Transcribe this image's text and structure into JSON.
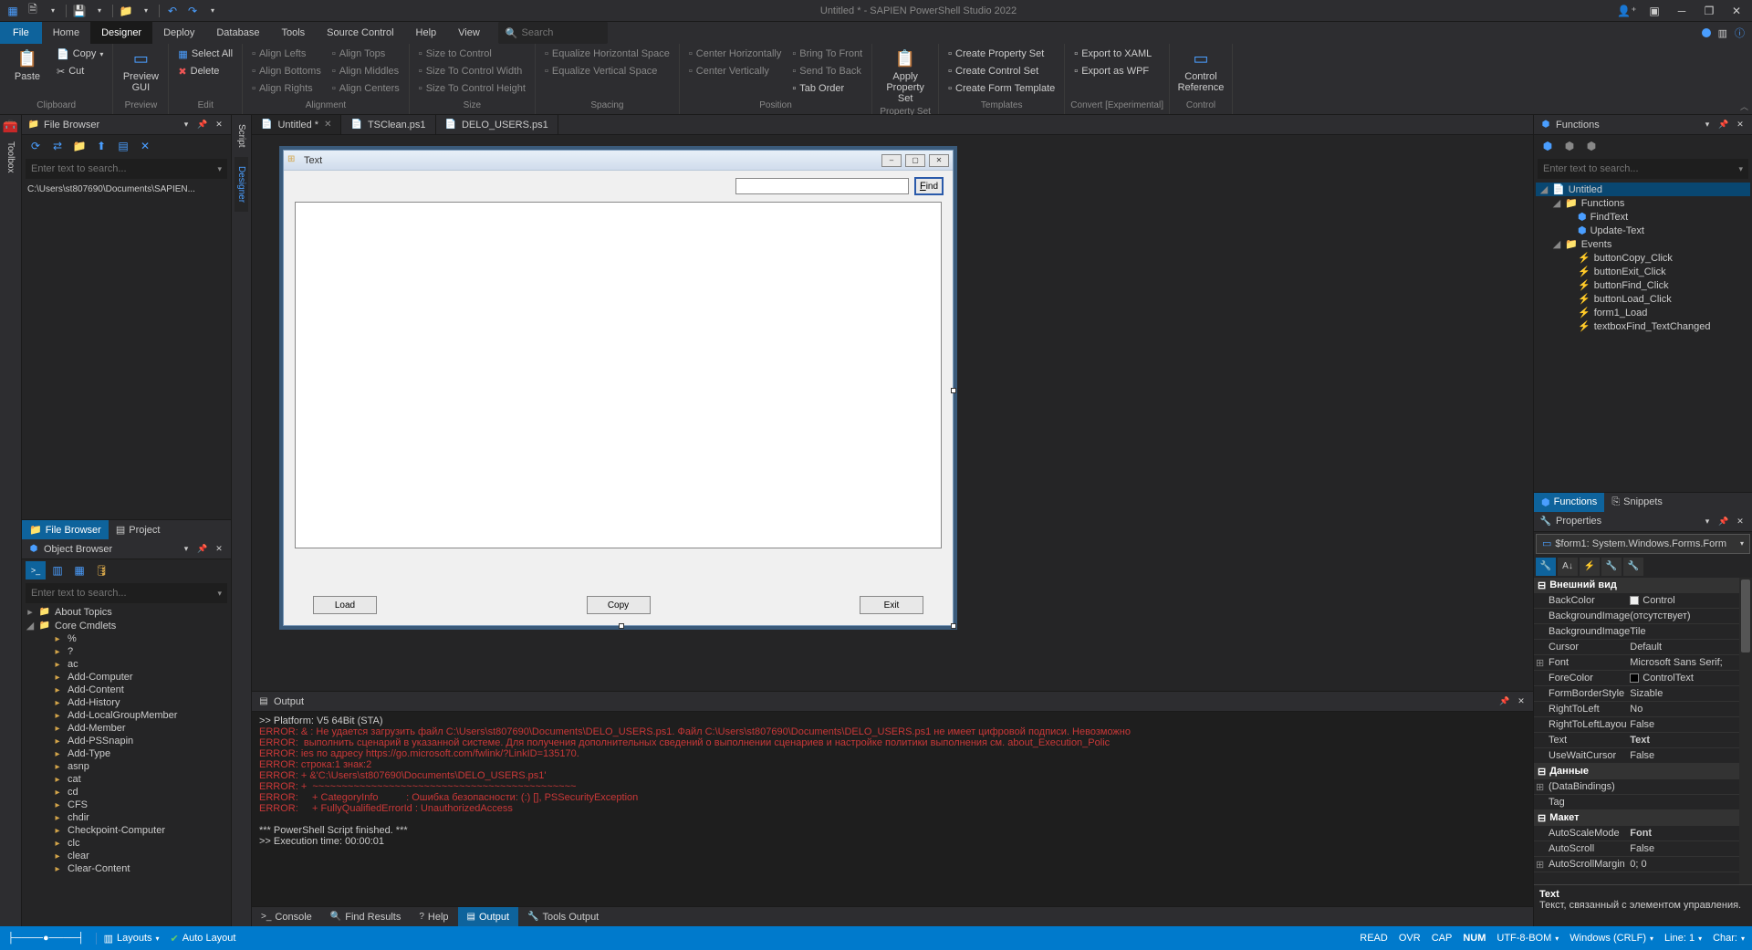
{
  "titlebar": {
    "title": "Untitled * - SAPIEN PowerShell Studio 2022"
  },
  "menu": {
    "file": "File",
    "items": [
      "Home",
      "Designer",
      "Deploy",
      "Database",
      "Tools",
      "Source Control",
      "Help",
      "View"
    ],
    "active": "Designer",
    "search_placeholder": "Search"
  },
  "ribbon": {
    "clipboard": {
      "label": "Clipboard",
      "paste": "Paste",
      "copy": "Copy",
      "cut": "Cut"
    },
    "preview": {
      "label": "Preview",
      "gui": "Preview\nGUI"
    },
    "edit": {
      "label": "Edit",
      "selectall": "Select All",
      "delete": "Delete"
    },
    "alignment": {
      "label": "Alignment",
      "items": [
        "Align Lefts",
        "Align Bottoms",
        "Align Rights",
        "Align Tops",
        "Align Middles",
        "Align Centers"
      ]
    },
    "size": {
      "label": "Size",
      "items": [
        "Size to Control",
        "Size To Control Width",
        "Size To Control Height"
      ]
    },
    "spacing": {
      "label": "Spacing",
      "items": [
        "Equalize Horizontal Space",
        "Equalize Vertical Space"
      ]
    },
    "position": {
      "label": "Position",
      "items": [
        "Center Horizontally",
        "Center Vertically",
        "Bring To Front",
        "Send To Back",
        "Tab Order"
      ]
    },
    "propertyset": {
      "label": "Property Set",
      "apply": "Apply\nProperty Set"
    },
    "templates": {
      "label": "Templates",
      "items": [
        "Create Property Set",
        "Create Control Set",
        "Create Form Template"
      ]
    },
    "convert": {
      "label": "Convert [Experimental]",
      "items": [
        "Export to XAML",
        "Export as WPF"
      ]
    },
    "control": {
      "label": "Control",
      "ref": "Control\nReference"
    }
  },
  "file_browser": {
    "title": "File Browser",
    "search_placeholder": "Enter text to search...",
    "path": "C:\\Users\\st807690\\Documents\\SAPIEN...",
    "tabs": [
      "File Browser",
      "Project"
    ],
    "active": "File Browser"
  },
  "object_browser": {
    "title": "Object Browser",
    "search_placeholder": "Enter text to search...",
    "roots": [
      {
        "exp": "▸",
        "label": "About Topics"
      },
      {
        "exp": "◢",
        "label": "Core Cmdlets"
      }
    ],
    "items": [
      "%",
      "?",
      "ac",
      "Add-Computer",
      "Add-Content",
      "Add-History",
      "Add-LocalGroupMember",
      "Add-Member",
      "Add-PSSnapin",
      "Add-Type",
      "asnp",
      "cat",
      "cd",
      "CFS",
      "chdir",
      "Checkpoint-Computer",
      "clc",
      "clear",
      "Clear-Content"
    ]
  },
  "doc_tabs": [
    {
      "label": "Untitled *",
      "active": true,
      "closable": true
    },
    {
      "label": "TSClean.ps1",
      "active": false
    },
    {
      "label": "DELO_USERS.ps1",
      "active": false
    }
  ],
  "side_tabs": {
    "script": "Script",
    "designer": "Designer"
  },
  "form": {
    "title": "Text",
    "find": "Find",
    "load": "Load",
    "copy": "Copy",
    "exit": "Exit"
  },
  "output": {
    "title": "Output",
    "lines": [
      {
        "t": ">> Platform: V5 64Bit (STA)",
        "err": false
      },
      {
        "t": "ERROR: & : Не удается загрузить файл C:\\Users\\st807690\\Documents\\DELO_USERS.ps1. Файл C:\\Users\\st807690\\Documents\\DELO_USERS.ps1 не имеет цифровой подписи. Невозможно",
        "err": true
      },
      {
        "t": "ERROR:  выполнить сценарий в указанной системе. Для получения дополнительных сведений о выполнении сценариев и настройке политики выполнения см. about_Execution_Polic",
        "err": true
      },
      {
        "t": "ERROR: ies по адресу https://go.microsoft.com/fwlink/?LinkID=135170.",
        "err": true
      },
      {
        "t": "ERROR: строка:1 знак:2",
        "err": true
      },
      {
        "t": "ERROR: + &'C:\\Users\\st807690\\Documents\\DELO_USERS.ps1'",
        "err": true
      },
      {
        "t": "ERROR: +  ~~~~~~~~~~~~~~~~~~~~~~~~~~~~~~~~~~~~~~~~~~~~~",
        "err": true
      },
      {
        "t": "ERROR:     + CategoryInfo          : Ошибка безопасности: (:) [], PSSecurityException",
        "err": true
      },
      {
        "t": "ERROR:     + FullyQualifiedErrorId : UnauthorizedAccess",
        "err": true
      },
      {
        "t": " ",
        "err": false
      },
      {
        "t": "*** PowerShell Script finished. ***",
        "err": false
      },
      {
        "t": ">> Execution time: 00:00:01",
        "err": false
      }
    ],
    "tabs": [
      "Console",
      "Find Results",
      "Help",
      "Output",
      "Tools Output"
    ],
    "active": "Output"
  },
  "functions": {
    "title": "Functions",
    "search_placeholder": "Enter text to search...",
    "root": "Untitled",
    "groups": [
      {
        "name": "Functions",
        "items": [
          "FindText",
          "Update-Text"
        ]
      },
      {
        "name": "Events",
        "items": [
          "buttonCopy_Click",
          "buttonExit_Click",
          "buttonFind_Click",
          "buttonLoad_Click",
          "form1_Load",
          "textboxFind_TextChanged"
        ]
      }
    ],
    "tabs": [
      "Functions",
      "Snippets"
    ],
    "active": "Functions"
  },
  "properties": {
    "title": "Properties",
    "object": "$form1: System.Windows.Forms.Form",
    "cats": [
      {
        "name": "Внешний вид",
        "rows": [
          {
            "n": "BackColor",
            "v": "Control",
            "swatch": "#f0f0f0"
          },
          {
            "n": "BackgroundImage",
            "v": "(отсутствует)"
          },
          {
            "n": "BackgroundImage",
            "v": "Tile"
          },
          {
            "n": "Cursor",
            "v": "Default"
          },
          {
            "n": "Font",
            "v": "Microsoft Sans Serif;",
            "exp": true
          },
          {
            "n": "ForeColor",
            "v": "ControlText",
            "swatch": "#000"
          },
          {
            "n": "FormBorderStyle",
            "v": "Sizable"
          },
          {
            "n": "RightToLeft",
            "v": "No"
          },
          {
            "n": "RightToLeftLayou",
            "v": "False"
          },
          {
            "n": "Text",
            "v": "Text",
            "bold": true
          },
          {
            "n": "UseWaitCursor",
            "v": "False"
          }
        ]
      },
      {
        "name": "Данные",
        "rows": [
          {
            "n": "(DataBindings)",
            "v": "",
            "exp": true
          },
          {
            "n": "Tag",
            "v": ""
          }
        ]
      },
      {
        "name": "Макет",
        "rows": [
          {
            "n": "AutoScaleMode",
            "v": "Font",
            "bold": true
          },
          {
            "n": "AutoScroll",
            "v": "False"
          },
          {
            "n": "AutoScrollMargin",
            "v": "0; 0",
            "exp": true
          }
        ]
      }
    ],
    "desc_title": "Text",
    "desc_body": "Текст, связанный с элементом управления."
  },
  "statusbar": {
    "layouts": "Layouts",
    "auto": "Auto Layout",
    "items": [
      "READ",
      "OVR",
      "CAP",
      "NUM",
      "UTF-8-BOM",
      "Windows (CRLF)",
      "Line: 1",
      "Char: "
    ]
  },
  "toolbox_label": "Toolbox"
}
